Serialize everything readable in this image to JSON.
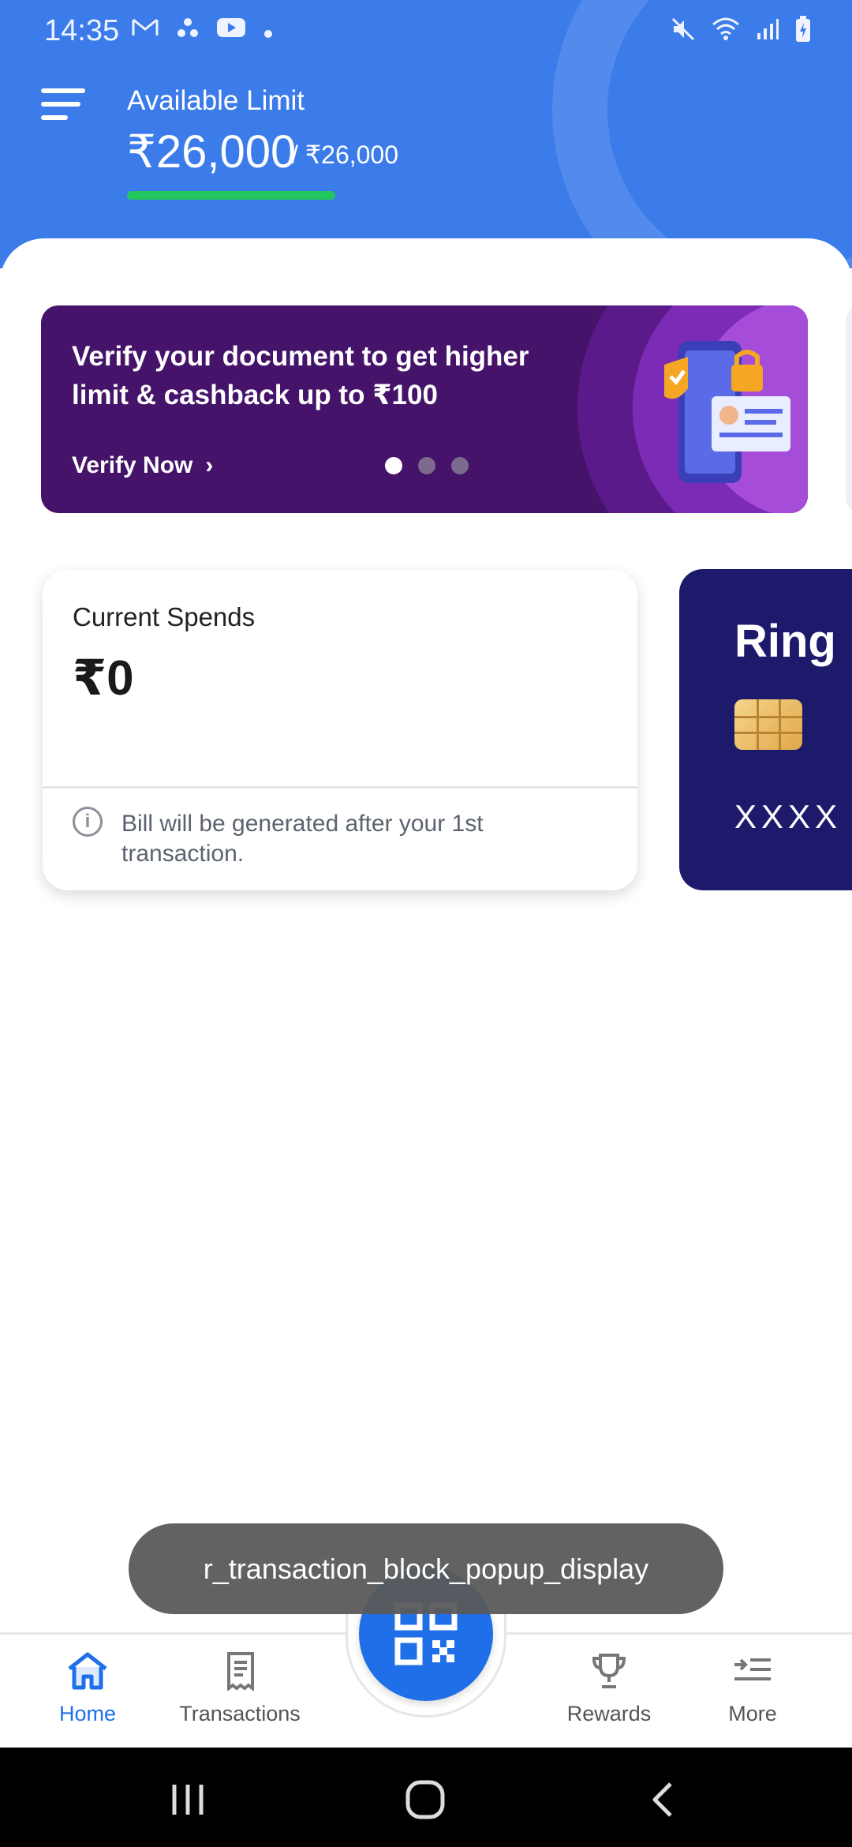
{
  "status_bar": {
    "time": "14:35",
    "left_icons": [
      "gmail-icon",
      "network-icon",
      "youtube-icon",
      "dot-icon"
    ],
    "right_icons": [
      "mute-icon",
      "wifi-icon",
      "signal-icon",
      "battery-icon"
    ]
  },
  "header": {
    "available_limit_label": "Available Limit",
    "available_amount": "₹26,000",
    "total_amount": "/ ₹26,000",
    "limit_fraction": 1.0,
    "progress_color": "#22C55E",
    "background_color": "#3B7BEA"
  },
  "promo": {
    "text": "Verify your document to get higher limit & cashback up to ₹100",
    "cta": "Verify Now",
    "cta_chevron": "›",
    "carousel": {
      "total": 3,
      "active_index": 0
    },
    "background_color": "#45136A"
  },
  "spends": {
    "label": "Current Spends",
    "value": "₹0",
    "info_icon": "i",
    "note": "Bill will be generated after your 1st transaction."
  },
  "card": {
    "brand": "Ring",
    "number_masked": "XXXX X",
    "background_color": "#1D1A6B"
  },
  "toast": {
    "text": "r_transaction_block_popup_display"
  },
  "bottom_nav": {
    "active_color": "#1E6FE8",
    "items": [
      {
        "label": "Home",
        "icon": "home-icon",
        "active": true
      },
      {
        "label": "Transactions",
        "icon": "receipt-icon",
        "active": false
      },
      {
        "label": "Rewards",
        "icon": "trophy-icon",
        "active": false
      },
      {
        "label": "More",
        "icon": "more-list-icon",
        "active": false
      }
    ],
    "center_action_icon": "qr-code-icon"
  },
  "system_nav": {
    "buttons": [
      "recents-icon",
      "home-icon",
      "back-icon"
    ]
  }
}
